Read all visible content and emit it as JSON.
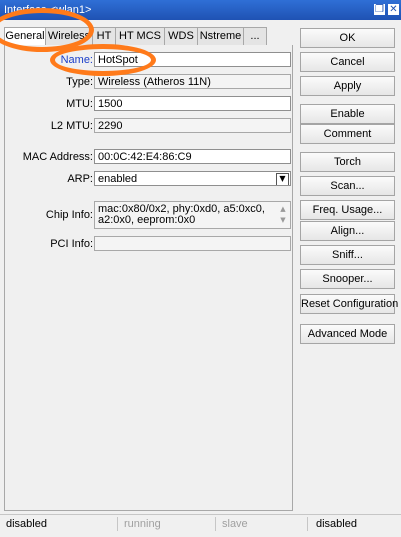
{
  "window": {
    "title": "Interface <wlan1>",
    "restore_glyph": "❐",
    "close_glyph": "✕"
  },
  "tabs": [
    {
      "label": "General",
      "active": true
    },
    {
      "label": "Wireless",
      "active": false
    },
    {
      "label": "HT",
      "active": false
    },
    {
      "label": "HT MCS",
      "active": false
    },
    {
      "label": "WDS",
      "active": false
    },
    {
      "label": "Nstreme",
      "active": false
    },
    {
      "label": "...",
      "active": false
    }
  ],
  "form": {
    "name_label": "Name:",
    "name_value": "HotSpot",
    "type_label": "Type:",
    "type_value": "Wireless (Atheros 11N)",
    "mtu_label": "MTU:",
    "mtu_value": "1500",
    "l2mtu_label": "L2 MTU:",
    "l2mtu_value": "2290",
    "mac_label": "MAC Address:",
    "mac_value": "00:0C:42:E4:86:C9",
    "arp_label": "ARP:",
    "arp_value": "enabled",
    "arp_drop_glyph": "▼",
    "chip_label": "Chip Info:",
    "chip_value": "mac:0x80/0x2, phy:0xd0, a5:0xc0, a2:0x0, eeprom:0x0",
    "chip_scroll_glyph": "▲\n▼",
    "pci_label": "PCI Info:",
    "pci_value": ""
  },
  "buttons": [
    "OK",
    "Cancel",
    "Apply",
    "Enable",
    "Comment",
    "Torch",
    "Scan...",
    "Freq. Usage...",
    "Align...",
    "Sniff...",
    "Snooper...",
    "Reset Configuration",
    "Advanced Mode"
  ],
  "status": [
    "disabled",
    "running",
    "slave",
    "disabled"
  ],
  "colors": {
    "titlebar": "#1f52b3",
    "highlight": "#ff7a1a",
    "name_label": "#1a3ec9"
  }
}
